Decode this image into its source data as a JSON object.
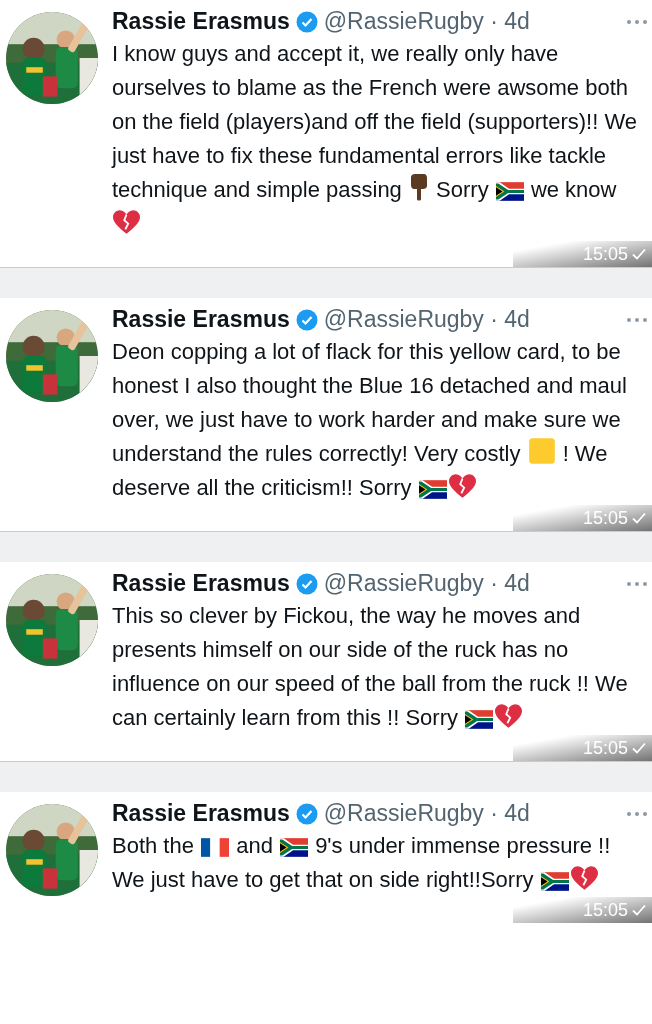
{
  "tweets": [
    {
      "name": "Rassie Erasmus",
      "handle": "@RassieRugby · 4d",
      "avatar": {
        "kind": "picture"
      },
      "segments": [
        {
          "kind": "text",
          "text": "I know guys and accept it, we really only have ourselves to blame as the French were awsome both on the field (players)and off the field (supporters)!! We just have to fix these fundamental errors like tackle technique and simple passing "
        },
        {
          "kind": "pointing-down"
        },
        {
          "kind": "text",
          "text": " Sorry "
        },
        {
          "kind": "south-africa-flag"
        },
        {
          "kind": "text",
          "text": " we know "
        },
        {
          "kind": "broken-heart"
        }
      ],
      "timestamp": "15:05"
    },
    {
      "name": "Rassie Erasmus",
      "handle": "@RassieRugby · 4d",
      "avatar": {
        "kind": "picture"
      },
      "segments": [
        {
          "kind": "text",
          "text": "Deon copping a lot of flack for this yellow card, to be honest I also thought the Blue 16 detached and maul over, we just have to work harder and make sure we understand the rules correctly! Very costly "
        },
        {
          "kind": "square"
        },
        {
          "kind": "text",
          "text": " ! We deserve all the criticism!!  Sorry "
        },
        {
          "kind": "south-africa-flag"
        },
        {
          "kind": "broken-heart"
        }
      ],
      "timestamp": "15:05"
    },
    {
      "name": "Rassie Erasmus",
      "handle": "@RassieRugby · 4d",
      "avatar": {
        "kind": "picture"
      },
      "segments": [
        {
          "kind": "text",
          "text": "This so clever by Fickou, the way he moves and presents himself on our side of the ruck has no influence on our speed of the ball from the ruck !! We can certainly learn from this !! Sorry "
        },
        {
          "kind": "south-africa-flag"
        },
        {
          "kind": "broken-heart"
        }
      ],
      "timestamp": "15:05"
    },
    {
      "name": "Rassie Erasmus",
      "handle": "@RassieRugby · 4d",
      "avatar": {
        "kind": "picture"
      },
      "segments": [
        {
          "kind": "text",
          "text": "Both the "
        },
        {
          "kind": "france-flag"
        },
        {
          "kind": "text",
          "text": " and "
        },
        {
          "kind": "south-africa-flag"
        },
        {
          "kind": "text",
          "text": " 9's under immense pressure !! We just have to get that on side right!!Sorry "
        },
        {
          "kind": "south-africa-flag"
        },
        {
          "kind": "broken-heart"
        }
      ],
      "timestamp": "15:05"
    }
  ]
}
